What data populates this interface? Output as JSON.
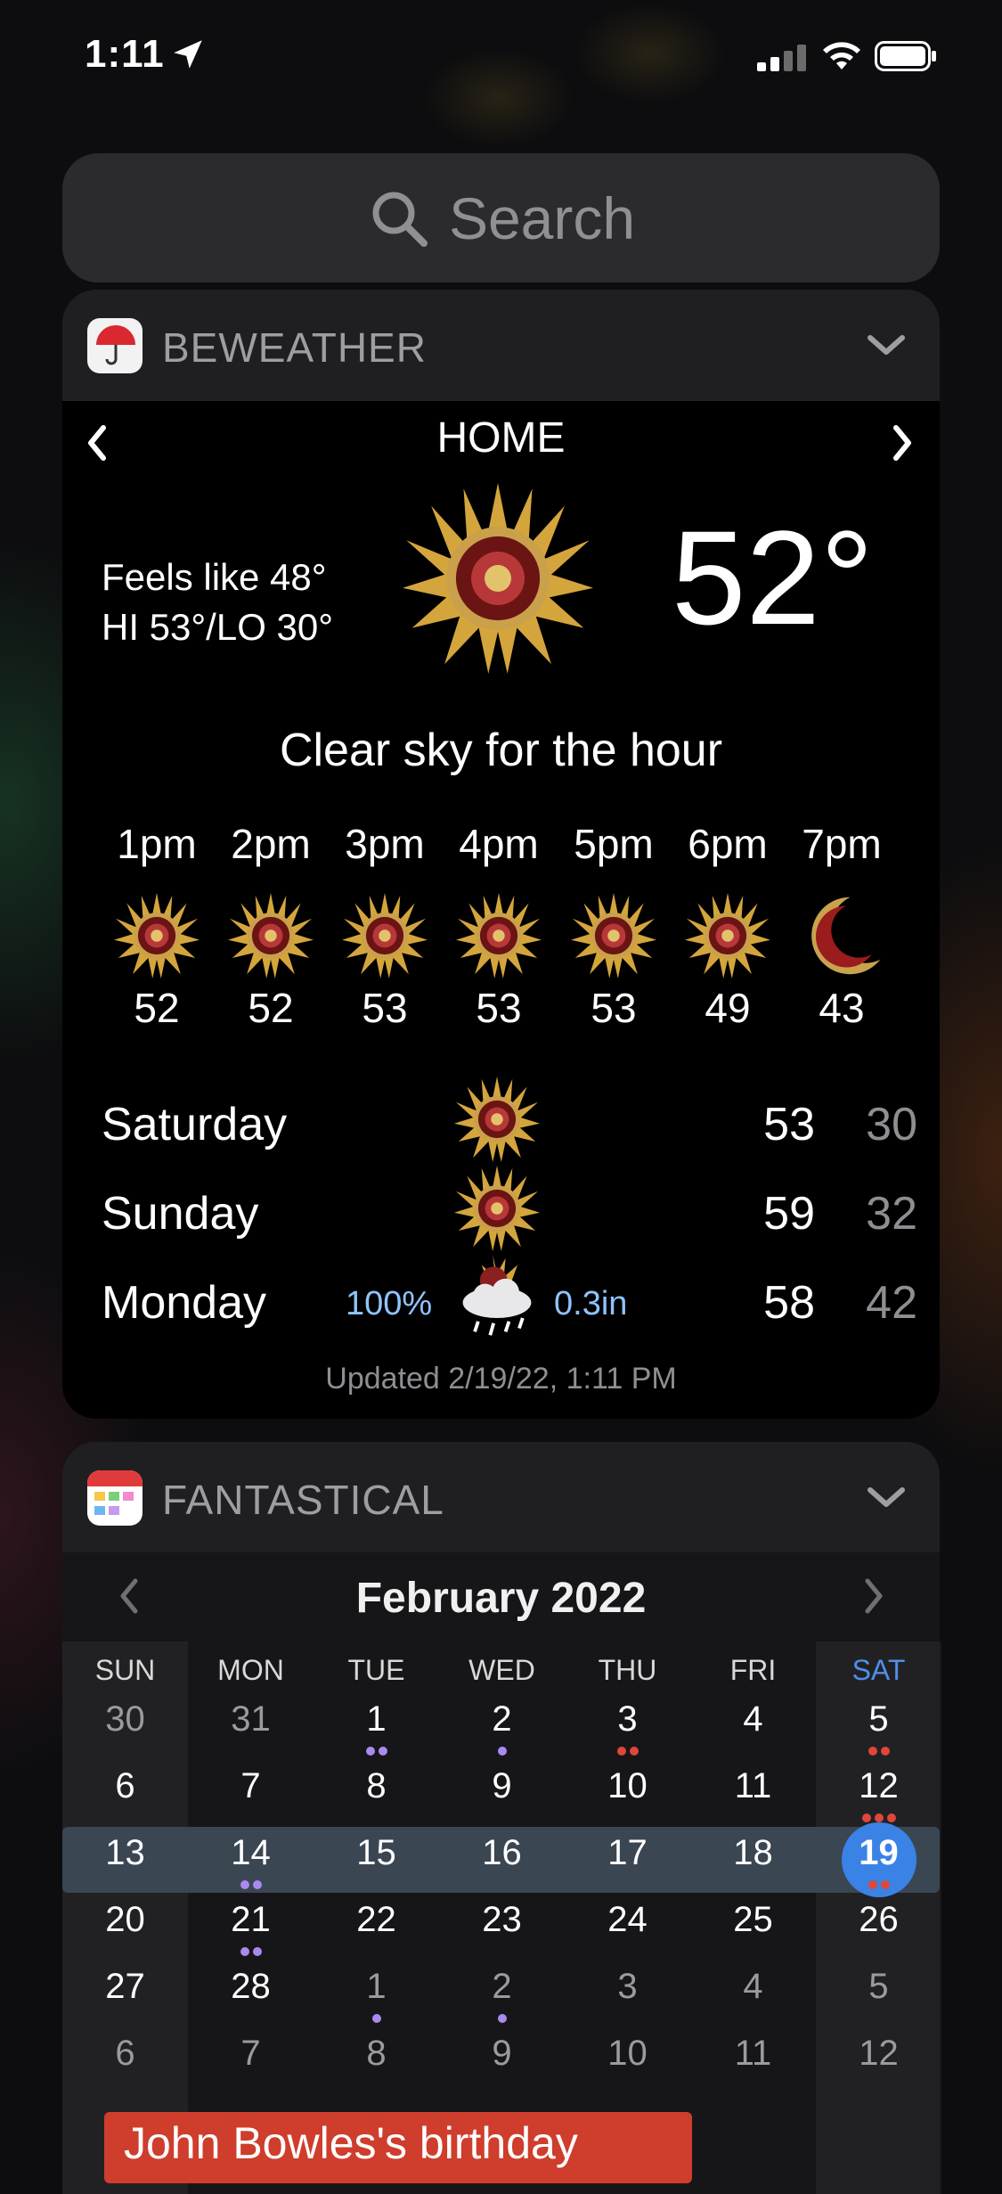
{
  "status_bar": {
    "time": "1:11"
  },
  "search": {
    "placeholder": "Search"
  },
  "beweather": {
    "app_name": "BEWEATHER",
    "location": "HOME",
    "feels_like": "Feels like 48°",
    "hi_lo": "HI 53°/LO 30°",
    "current_temp": "52°",
    "summary": "Clear sky for the hour",
    "hourly": [
      {
        "time": "1pm",
        "temp": "52",
        "icon": "sun-emblem-icon"
      },
      {
        "time": "2pm",
        "temp": "52",
        "icon": "sun-emblem-icon"
      },
      {
        "time": "3pm",
        "temp": "53",
        "icon": "sun-emblem-icon"
      },
      {
        "time": "4pm",
        "temp": "53",
        "icon": "sun-emblem-icon"
      },
      {
        "time": "5pm",
        "temp": "53",
        "icon": "sun-emblem-icon"
      },
      {
        "time": "6pm",
        "temp": "49",
        "icon": "sun-emblem-icon"
      },
      {
        "time": "7pm",
        "temp": "43",
        "icon": "moon-emblem-icon"
      }
    ],
    "daily": [
      {
        "day": "Saturday",
        "hi": "53",
        "lo": "30",
        "icon": "sun-emblem-icon",
        "precip_chance": "",
        "precip_amount": ""
      },
      {
        "day": "Sunday",
        "hi": "59",
        "lo": "32",
        "icon": "sun-emblem-icon",
        "precip_chance": "",
        "precip_amount": ""
      },
      {
        "day": "Monday",
        "hi": "58",
        "lo": "42",
        "icon": "rain-cloud-icon",
        "precip_chance": "100%",
        "precip_amount": "0.3in"
      }
    ],
    "updated": "Updated 2/19/22, 1:11 PM"
  },
  "fantastical": {
    "app_name": "FANTASTICAL",
    "month_title": "February 2022",
    "weekdays": [
      "SUN",
      "MON",
      "TUE",
      "WED",
      "THU",
      "FRI",
      "SAT"
    ],
    "weeks": [
      [
        "30",
        "31",
        "1",
        "2",
        "3",
        "4",
        "5"
      ],
      [
        "6",
        "7",
        "8",
        "9",
        "10",
        "11",
        "12"
      ],
      [
        "13",
        "14",
        "15",
        "16",
        "17",
        "18",
        "19"
      ],
      [
        "20",
        "21",
        "22",
        "23",
        "24",
        "25",
        "26"
      ],
      [
        "27",
        "28",
        "1",
        "2",
        "3",
        "4",
        "5"
      ],
      [
        "6",
        "7",
        "8",
        "9",
        "10",
        "11",
        "12"
      ]
    ],
    "today": "19",
    "event": "John Bowles's birthday",
    "colors": {
      "today": "#3b82e6",
      "weekend_header": "#4f8fe8",
      "dot_purple": "#a98af0",
      "dot_red": "#e0463a",
      "event": "#cf3d2c"
    }
  }
}
